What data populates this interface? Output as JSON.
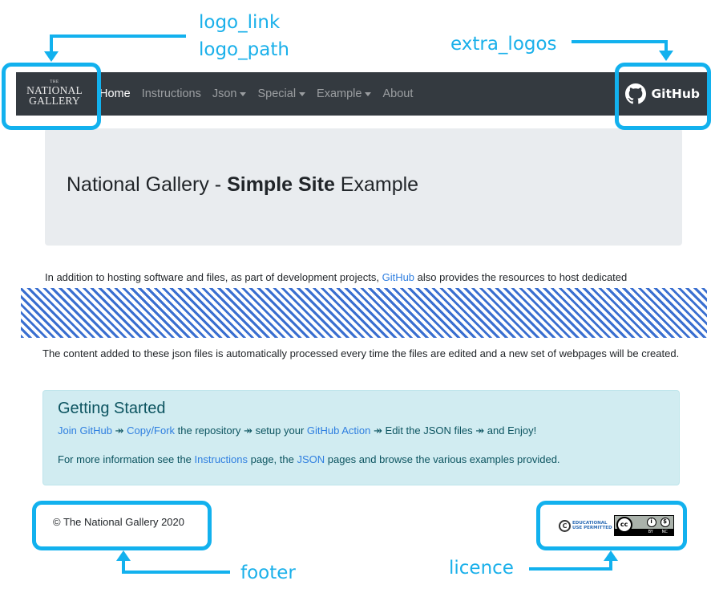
{
  "annotations": {
    "logo": [
      "logo_link",
      "logo_path"
    ],
    "extra_logos": "extra_logos",
    "footer": "footer",
    "licence": "licence",
    "accent_color": "#12b1ee"
  },
  "navbar": {
    "brand": {
      "small": "THE",
      "line1": "NATIONAL",
      "line2": "GALLERY"
    },
    "links": [
      {
        "label": "Home",
        "active": true,
        "dropdown": false
      },
      {
        "label": "Instructions",
        "active": false,
        "dropdown": false
      },
      {
        "label": "Json",
        "active": false,
        "dropdown": true
      },
      {
        "label": "Special",
        "active": false,
        "dropdown": true
      },
      {
        "label": "Example",
        "active": false,
        "dropdown": true
      },
      {
        "label": "About",
        "active": false,
        "dropdown": false
      }
    ],
    "extra_logo": {
      "icon": "github-octocat-icon",
      "label": "GitHub"
    },
    "background": "#343a40"
  },
  "jumbotron": {
    "title_prefix": "National Gallery - ",
    "title_bold": "Simple Site",
    "title_suffix": " Example"
  },
  "content": {
    "para1_before": "In addition to hosting software and files, as part of development projects, ",
    "para1_link": "GitHub",
    "para1_after": " also provides the resources to host dedicated",
    "para2": "The content added to these json files is automatically processed every time the files are edited and a new set of webpages will be created."
  },
  "getting_started": {
    "title": "Getting Started",
    "separator": "↠",
    "step1_link": "Join GitHub",
    "step2_link": "Copy/Fork",
    "step2_text": " the repository ",
    "step3_text": " setup your ",
    "step3_link": "GitHub Action",
    "step4_text": " Edit the JSON files ",
    "step5_text": " and Enjoy!",
    "info_before": "For more information see the ",
    "info_link1": "Instructions",
    "info_middle": " page, the ",
    "info_link2": "JSON",
    "info_after": " pages and browse the various examples provided."
  },
  "footer": {
    "text": "© The National Gallery 2020",
    "licence": {
      "edu_line1": "EDUCATIONAL",
      "edu_line2": "USE PERMITTED",
      "cc": "cc",
      "by": "BY",
      "nc": "NC"
    }
  }
}
